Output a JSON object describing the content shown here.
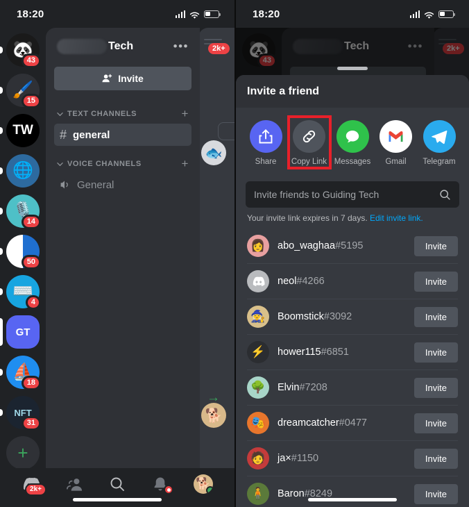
{
  "status_bar": {
    "time": "18:20"
  },
  "left_phone": {
    "servers": [
      {
        "name": "server-icon-panda",
        "badge": "43",
        "selected": false,
        "emoji": "🐼",
        "bg": "#1a1a1a",
        "unread": true
      },
      {
        "name": "server-icon-paint",
        "badge": "15",
        "selected": false,
        "emoji": "🖌️",
        "bg": "#2f3136",
        "unread": true
      },
      {
        "name": "server-icon-tw",
        "badge": "",
        "selected": false,
        "label": "TW",
        "bg": "#000000",
        "unread": true
      },
      {
        "name": "server-icon-wordpress",
        "badge": "",
        "selected": false,
        "emoji": "🌐",
        "bg": "#2d6a9f",
        "unread": true
      },
      {
        "name": "server-icon-mic",
        "badge": "14",
        "selected": false,
        "emoji": "🎙️",
        "bg": "#4ec0c7",
        "unread": true
      },
      {
        "name": "server-icon-blue",
        "badge": "50",
        "selected": false,
        "emoji": "🔵",
        "bg": "#1f6fd0",
        "unread": true
      },
      {
        "name": "server-icon-typewriter",
        "badge": "4",
        "selected": false,
        "emoji": "⌨️",
        "bg": "#17a5e0",
        "unread": true
      },
      {
        "name": "server-icon-gt",
        "badge": "",
        "selected": true,
        "label": "GT",
        "bg": "#5865f2",
        "unread": false
      },
      {
        "name": "server-icon-sail",
        "badge": "18",
        "selected": false,
        "emoji": "⛵",
        "bg": "#1f8ef0",
        "unread": true
      },
      {
        "name": "server-icon-nft",
        "badge": "31",
        "selected": false,
        "label": "NFT",
        "bg": "#1b2430",
        "unread": true
      }
    ],
    "add_server_label": "+",
    "explore_label": "⛬",
    "header": {
      "server_name": "Tech",
      "more_label": "•••",
      "invite_label": "Invite"
    },
    "text_channels": {
      "category": "TEXT CHANNELS",
      "add": "+",
      "channels": [
        {
          "name": "general",
          "active": true
        }
      ]
    },
    "voice_channels": {
      "category": "VOICE CHANNELS",
      "add": "+",
      "channels": [
        {
          "name": "General"
        }
      ]
    },
    "peek_panel": {
      "badge": "2k+",
      "avatar": "🐟",
      "arrow": "→",
      "bottom_avatar": "🐕"
    },
    "bottom_nav": [
      {
        "name": "nav-servers",
        "badge": "2k+",
        "icon": "discord"
      },
      {
        "name": "nav-friends",
        "badge": "",
        "icon": "friends"
      },
      {
        "name": "nav-search",
        "badge": "",
        "icon": "search"
      },
      {
        "name": "nav-notifications",
        "badge": "dot",
        "icon": "bell"
      },
      {
        "name": "nav-profile",
        "badge": "",
        "icon": "avatar",
        "emoji": "🐕"
      }
    ]
  },
  "right_phone": {
    "header": {
      "server_name": "Tech",
      "more_label": "•••"
    },
    "sheet": {
      "title": "Invite a friend",
      "share_options": [
        {
          "label": "Share",
          "icon": "share-icon",
          "bg": "#5865f2",
          "highlight": false
        },
        {
          "label": "Copy Link",
          "icon": "link-icon",
          "bg": "#4f545c",
          "highlight": true
        },
        {
          "label": "Messages",
          "icon": "messages-icon",
          "bg": "#2fc24b",
          "highlight": false
        },
        {
          "label": "Gmail",
          "icon": "gmail-icon",
          "bg": "#ffffff",
          "highlight": false
        },
        {
          "label": "Telegram",
          "icon": "telegram-icon",
          "bg": "#2aabee",
          "highlight": false
        }
      ],
      "search_placeholder": "Invite friends to Guiding Tech",
      "expiry_text": "Your invite link expires in 7 days.",
      "edit_link_label": "Edit invite link.",
      "invite_button_label": "Invite",
      "friends": [
        {
          "username": "abo_waghaa",
          "tag": "#5195",
          "avatar_bg": "#e8a0a0",
          "emoji": "👩"
        },
        {
          "username": "neol",
          "tag": "#4266",
          "avatar_bg": "#b9bbbe",
          "emoji": "🎮"
        },
        {
          "username": "Boomstick",
          "tag": "#3092",
          "avatar_bg": "#d9c08a",
          "emoji": "🧙"
        },
        {
          "username": "hower115",
          "tag": "#6851",
          "avatar_bg": "#2b2d31",
          "emoji": "⚡"
        },
        {
          "username": "Elvin",
          "tag": "#7208",
          "avatar_bg": "#a8d5c8",
          "emoji": "🌳"
        },
        {
          "username": "dreamcatcher",
          "tag": "#0477",
          "avatar_bg": "#e8762c",
          "emoji": "🎭"
        },
        {
          "username": "ja×",
          "tag": "#1150",
          "avatar_bg": "#c43b3b",
          "emoji": "🧑"
        },
        {
          "username": "Baron",
          "tag": "#8249",
          "avatar_bg": "#5b7a3a",
          "emoji": "🧍"
        }
      ]
    },
    "peek_panel": {
      "badge": "2k+"
    }
  },
  "colors": {
    "accent": "#5865f2",
    "danger": "#ed4245",
    "highlight": "#e8202a",
    "link": "#00a8fc"
  }
}
